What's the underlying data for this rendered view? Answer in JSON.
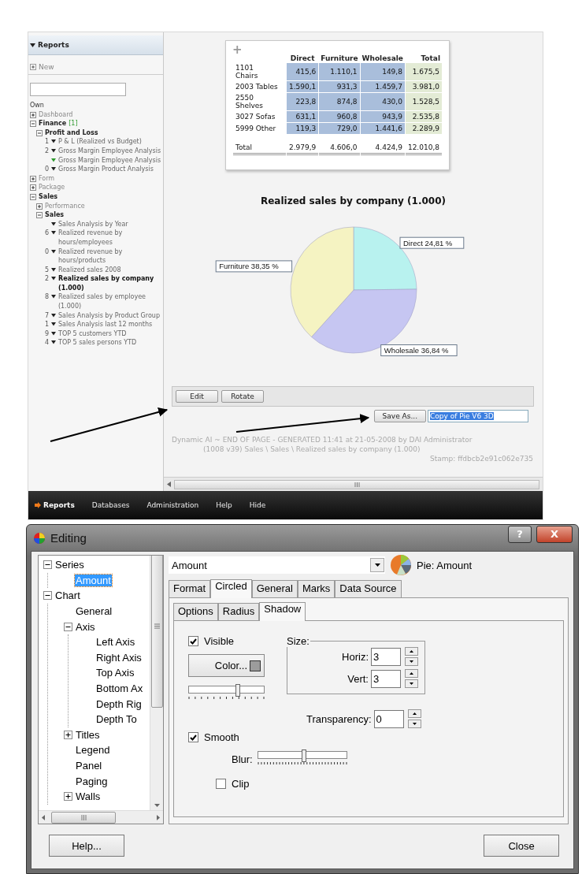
{
  "report_page": {
    "sidebar": {
      "title": "Reports",
      "new_label": "New",
      "tree": [
        {
          "kind": "heading",
          "label": "Own"
        },
        {
          "kind": "folder",
          "label": "Dashboard",
          "expanded": false
        },
        {
          "kind": "folder",
          "label": "Finance",
          "badge": "[1]",
          "expanded": true,
          "children": [
            {
              "kind": "folder",
              "label": "Profit and Loss",
              "expanded": true,
              "children": [
                {
                  "kind": "report",
                  "count": "1",
                  "label": "P & L (Realized vs Budget)",
                  "color": "#222222",
                  "selected": false
                },
                {
                  "kind": "report",
                  "count": "2",
                  "label": "Gross Margin Employee Analysis",
                  "color": "#222222",
                  "selected": false
                },
                {
                  "kind": "report",
                  "label": "Gross Margin Employee Analysis",
                  "color": "#2e9a2e",
                  "selected": false
                },
                {
                  "kind": "report",
                  "count": "0",
                  "label": "Gross Margin Product Analysis",
                  "color": "#222222",
                  "selected": false
                }
              ]
            }
          ]
        },
        {
          "kind": "folder",
          "label": "Form",
          "expanded": false
        },
        {
          "kind": "folder",
          "label": "Package",
          "expanded": false
        },
        {
          "kind": "folder",
          "label": "Sales",
          "expanded": true,
          "children": [
            {
              "kind": "folder",
              "label": "Performance",
              "expanded": false
            },
            {
              "kind": "folder",
              "label": "Sales",
              "expanded": true,
              "children": [
                {
                  "kind": "report",
                  "label": "Sales Analysis by Year",
                  "color": "#222222",
                  "selected": false
                },
                {
                  "kind": "report",
                  "count": "6",
                  "label": "Realized revenue by hours/employees",
                  "color": "#222222",
                  "selected": false
                },
                {
                  "kind": "report",
                  "count": "0",
                  "label": "Realized revenue by hours/products",
                  "color": "#222222",
                  "selected": false
                },
                {
                  "kind": "report",
                  "count": "5",
                  "label": "Realized sales 2008",
                  "color": "#222222",
                  "selected": false
                },
                {
                  "kind": "report",
                  "count": "2",
                  "label": "Realized sales by company (1.000)",
                  "color": "#222222",
                  "selected": true
                },
                {
                  "kind": "report",
                  "count": "8",
                  "label": "Realized sales by employee (1.000)",
                  "color": "#222222",
                  "selected": false
                },
                {
                  "kind": "report",
                  "count": "7",
                  "label": "Sales Analysis by Product Group",
                  "color": "#222222",
                  "selected": false
                },
                {
                  "kind": "report",
                  "count": "1",
                  "label": "Sales Analysis last 12 months",
                  "color": "#222222",
                  "selected": false
                },
                {
                  "kind": "report",
                  "count": "9",
                  "label": "TOP 5 customers YTD",
                  "color": "#222222",
                  "selected": false
                },
                {
                  "kind": "report",
                  "count": "4",
                  "label": "TOP 5 sales persons YTD",
                  "color": "#222222",
                  "selected": false
                }
              ]
            }
          ]
        }
      ]
    },
    "table": {
      "add_glyph": "+",
      "columns": [
        "Direct",
        "Furniture",
        "Wholesale",
        "Total"
      ],
      "rows": [
        {
          "label": "1101 Chairs",
          "cells": [
            "415,6",
            "1.110,1",
            "149,8",
            "1.675,5"
          ]
        },
        {
          "label": "2003 Tables",
          "cells": [
            "1.590,1",
            "931,3",
            "1.459,7",
            "3.981,0"
          ]
        },
        {
          "label": "2550 Shelves",
          "cells": [
            "223,8",
            "874,8",
            "430,0",
            "1.528,5"
          ]
        },
        {
          "label": "3027 Sofas",
          "cells": [
            "631,1",
            "960,8",
            "943,9",
            "2.535,8"
          ]
        },
        {
          "label": "5999 Other",
          "cells": [
            "119,3",
            "729,0",
            "1.441,6",
            "2.289,9"
          ]
        }
      ],
      "total": {
        "label": "Total",
        "cells": [
          "2.979,9",
          "4.606,0",
          "4.424,9",
          "12.010,8"
        ]
      }
    },
    "chart": {
      "chart_data": {
        "type": "pie",
        "title": "Realized sales by company (1.000)",
        "categories": [
          "Direct",
          "Wholesale",
          "Furniture"
        ],
        "values": [
          24.81,
          36.84,
          38.35
        ],
        "value_labels": [
          "24,81 %",
          "36,84 %",
          "38,35 %"
        ]
      }
    },
    "buttons": [
      "Edit",
      "Rotate"
    ],
    "save_button": "Save As...",
    "name_field": {
      "value": "Copy of Pie V6 3D",
      "selected": true
    },
    "footer": {
      "lines": [
        "Dynamic AI ~ END OF PAGE - GENERATED 11:41 at 21-05-2008 by DAI Administrator",
        "(1008 v39) Sales \\ Sales \\ Realized sales by company (1.000)"
      ],
      "stamp": "Stamp: ffdbcb2e91c062e735"
    },
    "nav": [
      {
        "label": "Reports",
        "selected": true
      },
      {
        "label": "Databases",
        "selected": false
      },
      {
        "label": "Administration",
        "selected": false
      },
      {
        "label": "Help",
        "selected": false
      },
      {
        "label": "Hide",
        "selected": false
      }
    ]
  },
  "dialog": {
    "title": "Editing",
    "help_glyph": "?",
    "close_glyph": "X",
    "tree": [
      {
        "label": "Series",
        "expanded": true,
        "selected": false,
        "children": [
          {
            "label": "Amount",
            "selected": true
          }
        ]
      },
      {
        "label": "Chart",
        "expanded": true,
        "selected": false,
        "children": [
          {
            "label": "General",
            "selected": false
          },
          {
            "label": "Axis",
            "expanded": true,
            "selected": false,
            "children": [
              {
                "label": "Left Axis",
                "selected": false
              },
              {
                "label": "Right Axis",
                "selected": false
              },
              {
                "label": "Top Axis",
                "selected": false
              },
              {
                "label": "Bottom Ax",
                "selected": false
              },
              {
                "label": "Depth Rig",
                "selected": false
              },
              {
                "label": "Depth To",
                "selected": false
              }
            ]
          },
          {
            "label": "Titles",
            "expanded": false,
            "selected": false
          },
          {
            "label": "Legend",
            "selected": false
          },
          {
            "label": "Panel",
            "selected": false
          },
          {
            "label": "Paging",
            "selected": false
          },
          {
            "label": "Walls",
            "expanded": false,
            "selected": false
          }
        ]
      }
    ],
    "series_select": {
      "value": "Amount"
    },
    "series_caption": "Pie: Amount",
    "tabs": [
      {
        "label": "Format",
        "selected": false
      },
      {
        "label": "Circled",
        "selected": true
      },
      {
        "label": "General",
        "selected": false
      },
      {
        "label": "Marks",
        "selected": false
      },
      {
        "label": "Data Source",
        "selected": false
      }
    ],
    "subtabs": [
      {
        "label": "Options",
        "selected": false
      },
      {
        "label": "Radius",
        "selected": false
      },
      {
        "label": "Shadow",
        "selected": true
      }
    ],
    "visible": {
      "label": "Visible",
      "checked": true
    },
    "color_button": "Color...",
    "color_slider": {
      "level": 0.65
    },
    "size_group": {
      "title": "Size:",
      "horiz": {
        "label": "Horiz:",
        "value": "3"
      },
      "vert": {
        "label": "Vert:",
        "value": "3"
      }
    },
    "transparency": {
      "label": "Transparency:",
      "value": "0"
    },
    "smooth": {
      "label": "Smooth",
      "checked": true
    },
    "blur": {
      "label": "Blur:",
      "level": 0.52
    },
    "clip": {
      "label": "Clip",
      "checked": false
    },
    "help_button": "Help...",
    "close_button": "Close"
  }
}
